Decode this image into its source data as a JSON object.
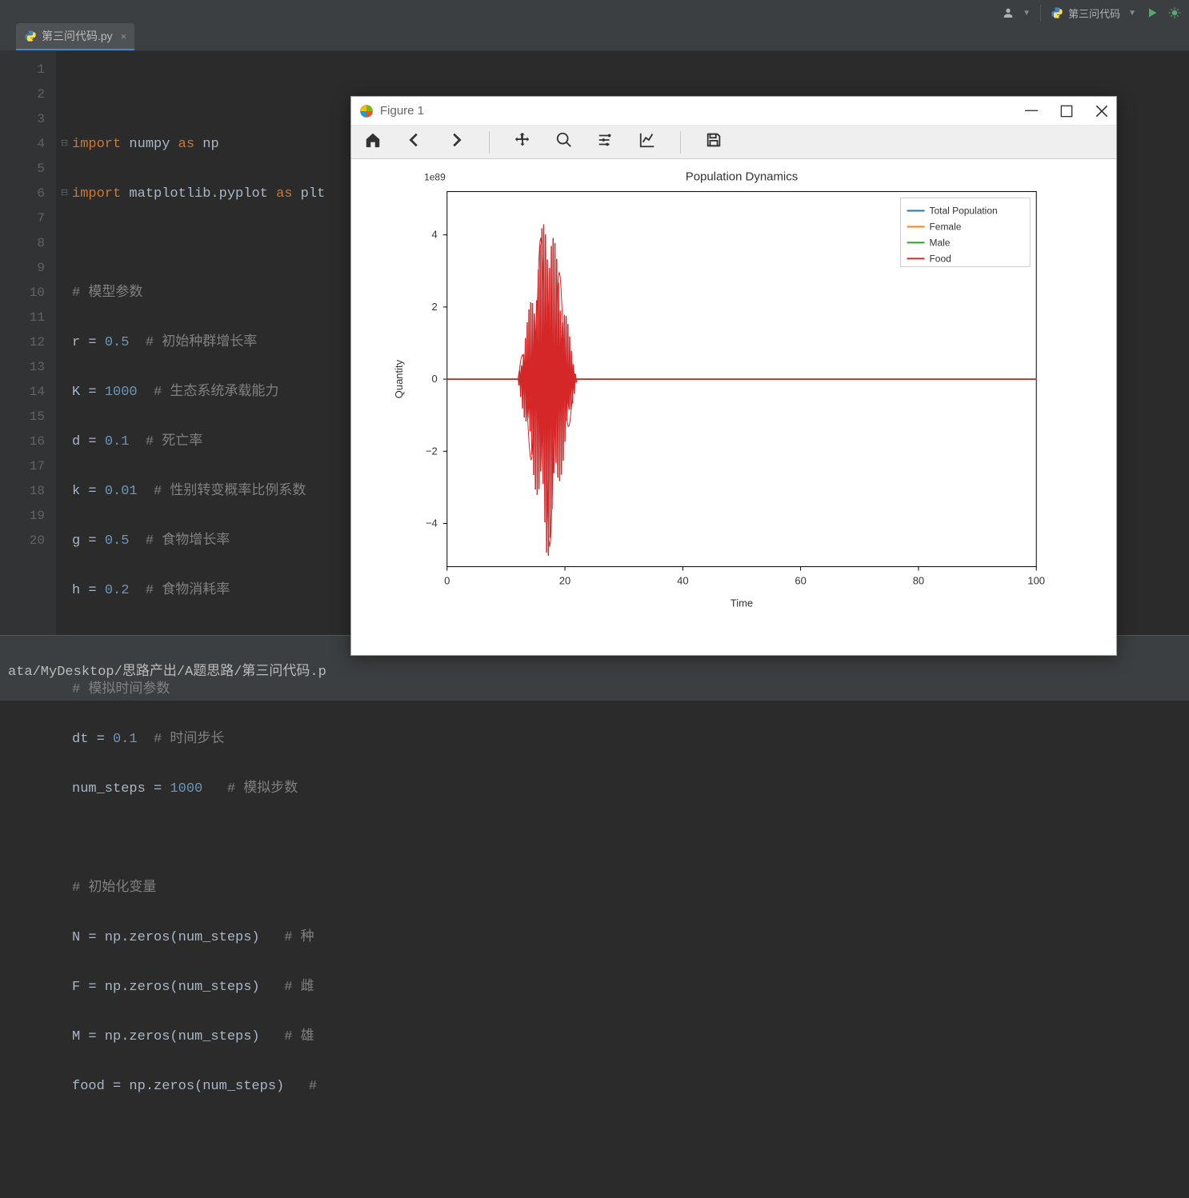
{
  "top_toolbar": {
    "config_name": "第三问代码"
  },
  "tab": {
    "filename": "第三问代码.py"
  },
  "gutter": {
    "lines": [
      "1",
      "2",
      "3",
      "4",
      "5",
      "6",
      "7",
      "8",
      "9",
      "10",
      "11",
      "12",
      "13",
      "14",
      "15",
      "16",
      "17",
      "18",
      "19",
      "20"
    ]
  },
  "code": {
    "l1_kw": "import",
    "l1_a": " numpy ",
    "l1_as": "as",
    "l1_b": " np",
    "l2_kw": "import",
    "l2_a": " matplotlib.pyplot ",
    "l2_as": "as",
    "l2_b": " plt",
    "l4": "# 模型参数",
    "l5a": "r = ",
    "l5n": "0.5",
    "l5c": "  # 初始种群增长率",
    "l6a": "K = ",
    "l6n": "1000",
    "l6c": "  # 生态系统承载能力",
    "l7a": "d = ",
    "l7n": "0.1",
    "l7c": "  # 死亡率",
    "l8a": "k = ",
    "l8n": "0.01",
    "l8c": "  # 性别转变概率比例系数",
    "l9a": "g = ",
    "l9n": "0.5",
    "l9c": "  # 食物增长率",
    "l10a": "h = ",
    "l10n": "0.2",
    "l10c": "  # 食物消耗率",
    "l12": "# 模拟时间参数",
    "l13a": "dt = ",
    "l13n": "0.1",
    "l13c": "  # 时间步长",
    "l14a": "num_steps = ",
    "l14n": "1000",
    "l14c": "   # 模拟步数",
    "l16": "# 初始化变量",
    "l17a": "N = np.zeros(num_steps)",
    "l17c": "   # 种",
    "l18a": "F = np.zeros(num_steps)",
    "l18c": "   # 雌",
    "l19a": "M = np.zeros(num_steps)",
    "l19c": "   # 雄",
    "l20a": "food = np.zeros(num_steps)",
    "l20c": "   #"
  },
  "status": {
    "path": "ata/MyDesktop/思路产出/A题思路/第三问代码.p"
  },
  "figure": {
    "title": "Figure 1"
  },
  "chart_data": {
    "type": "line",
    "title": "Population Dynamics",
    "xlabel": "Time",
    "ylabel": "Quantity",
    "y_scale_label": "1e89",
    "x_ticks": [
      0,
      20,
      40,
      60,
      80,
      100
    ],
    "y_ticks": [
      -4,
      -2,
      0,
      2,
      4
    ],
    "xlim": [
      0,
      100
    ],
    "ylim": [
      -5.2,
      5.2
    ],
    "series": [
      {
        "name": "Total Population",
        "color": "#1f77b4",
        "description": "flat at 0 across full range"
      },
      {
        "name": "Female",
        "color": "#ff7f0e",
        "description": "flat at 0 across full range"
      },
      {
        "name": "Male",
        "color": "#2ca02c",
        "description": "flat at 0 across full range"
      },
      {
        "name": "Food",
        "color": "#d62728",
        "description": "flat at 0 except violent oscillation burst between x≈12 and x≈22 with amplitude ramping from 0 up to ±5e89 then back to 0"
      }
    ],
    "legend_position": "upper right"
  }
}
